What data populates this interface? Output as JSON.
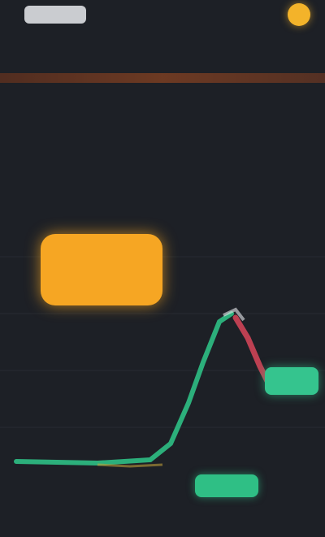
{
  "header": {
    "logo_icon": "brand-logo",
    "coin_icon": "coin-icon"
  },
  "tabs": [
    {
      "label": ""
    },
    {
      "label": ""
    },
    {
      "label": ""
    },
    {
      "label": ""
    },
    {
      "label": ""
    }
  ],
  "banner": {
    "text": ""
  },
  "ticker": {
    "price": "",
    "change": "",
    "price_color": "#2fbf85"
  },
  "stats_left": {
    "label1": "",
    "value1": "",
    "label2": "",
    "value2": ""
  },
  "stats_right": {
    "label1": "",
    "value1": "",
    "label2": "",
    "value2": ""
  },
  "timeframes": [
    {
      "label": ""
    },
    {
      "label": ""
    },
    {
      "label": ""
    },
    {
      "label": ""
    }
  ],
  "trade_button": {
    "label": "",
    "color": "#f6a623"
  },
  "chart": {
    "up_color": "#2fbf85",
    "down_color": "#d9465a",
    "price_tag": "",
    "volume_label": "",
    "volume_value": "",
    "yaxis_labels": [
      "",
      "",
      "",
      "",
      "",
      ""
    ]
  }
}
